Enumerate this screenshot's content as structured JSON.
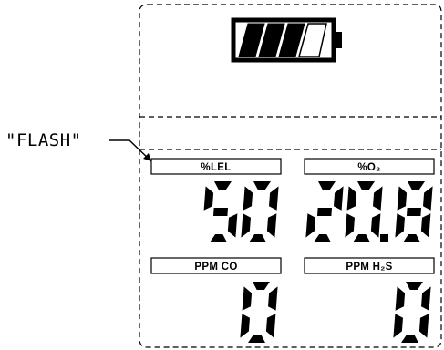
{
  "callout": {
    "text": "\"FLASH\""
  },
  "battery": {
    "icon": "battery-icon",
    "level_fraction": 0.72
  },
  "readings": [
    {
      "label": "%LEL",
      "value": "50"
    },
    {
      "label": "%O₂",
      "value": "20.8"
    },
    {
      "label": "PPM CO",
      "value": "0"
    },
    {
      "label": "PPM H₂S",
      "value": "0"
    }
  ],
  "colors": {
    "ink": "#000000",
    "background": "#ffffff"
  }
}
